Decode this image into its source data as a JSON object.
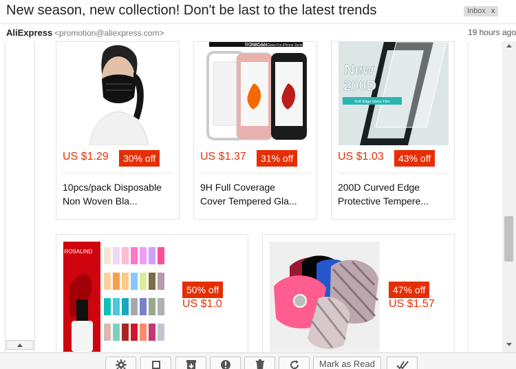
{
  "email": {
    "subject": "New season, new collection! Don't be last to the latest trends",
    "badge": "Inbox",
    "badge_close": "x",
    "sender_name": "AliExpress",
    "sender_email": "<promotion@aliexpress.com>",
    "time": "19 hours ago"
  },
  "products_top": [
    {
      "price": "US $1.29",
      "discount": "30% off",
      "title_line1": "10pcs/pack Disposable",
      "title_line2": "Non Woven Bla..."
    },
    {
      "price": "US $1.37",
      "discount": "31% off",
      "title_line1": "9H Full Coverage",
      "title_line2": "Cover Tempered Gla...",
      "image_text": "RONICAN",
      "image_caption": "Full Cover Glass For iPhone Series"
    },
    {
      "price": "US $1.03",
      "discount": "43% off",
      "title_line1": "200D Curved Edge",
      "title_line2": "Protective Tempere...",
      "image_text": "New",
      "image_text2": "200D",
      "image_caption": "Soft Edge Glass Film"
    }
  ],
  "products_bottom": [
    {
      "discount": "50% off",
      "price": "US $1.0",
      "image_text": "ROSALIND"
    },
    {
      "discount": "47% off",
      "price": "US $1.57"
    }
  ],
  "toolbar": {
    "mark_read_label": "Mark as Read"
  },
  "colors": {
    "accent": "#e62e04",
    "text": "#222222",
    "muted": "#777777"
  }
}
